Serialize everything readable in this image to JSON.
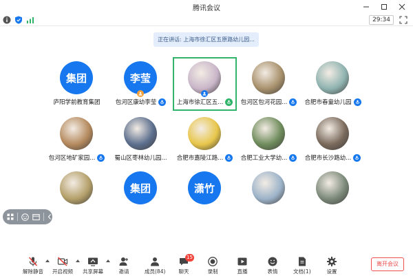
{
  "window": {
    "title": "腾讯会议"
  },
  "status": {
    "timer": "29:34"
  },
  "speaking": {
    "text": "正在讲话: 上海市徐汇区五原路幼儿园..."
  },
  "participants": [
    {
      "name": "庐阳学前教育集团",
      "avatar_text": "集团",
      "photo": false,
      "badge": "",
      "mic": false,
      "active": false
    },
    {
      "name": "包河区康幼李莹",
      "avatar_text": "李莹",
      "photo": false,
      "badge": "host",
      "mic": true,
      "active": false
    },
    {
      "name": "上海市徐汇区五...",
      "avatar_text": "",
      "photo": true,
      "photo_color": "#c9b6c9",
      "badge": "cohost",
      "mic": true,
      "active": true
    },
    {
      "name": "包河区包河花园...",
      "avatar_text": "",
      "photo": true,
      "photo_color": "#a8916c",
      "badge": "",
      "mic": true,
      "active": false
    },
    {
      "name": "合肥市春童幼儿园",
      "avatar_text": "",
      "photo": true,
      "photo_color": "#8fb3b0",
      "badge": "",
      "mic": true,
      "active": false
    },
    {
      "name": "包河区地矿家园...",
      "avatar_text": "",
      "photo": true,
      "photo_color": "#b58a5e",
      "badge": "",
      "mic": true,
      "active": false
    },
    {
      "name": "蜀山区枣林幼儿园...",
      "avatar_text": "",
      "photo": true,
      "photo_color": "#5c6f8e",
      "badge": "",
      "mic": false,
      "active": false
    },
    {
      "name": "合肥市嘉陵江路...",
      "avatar_text": "",
      "photo": true,
      "photo_color": "#e8c64b",
      "badge": "",
      "mic": true,
      "active": false
    },
    {
      "name": "合肥工业大学幼...",
      "avatar_text": "",
      "photo": true,
      "photo_color": "#6f8c5c",
      "badge": "",
      "mic": true,
      "active": false
    },
    {
      "name": "合肥市长沙路幼...",
      "avatar_text": "",
      "photo": true,
      "photo_color": "#7a6a5c",
      "badge": "",
      "mic": true,
      "active": false
    },
    {
      "name": "",
      "avatar_text": "",
      "photo": true,
      "photo_color": "#b4a06a",
      "badge": "",
      "mic": false,
      "active": false
    },
    {
      "name": "",
      "avatar_text": "集团",
      "photo": false,
      "badge": "",
      "mic": false,
      "active": false
    },
    {
      "name": "",
      "avatar_text": "潇竹",
      "photo": false,
      "badge": "",
      "mic": false,
      "active": false
    },
    {
      "name": "",
      "avatar_text": "",
      "photo": true,
      "photo_color": "#9cb3c9",
      "badge": "",
      "mic": false,
      "active": false
    },
    {
      "name": "",
      "avatar_text": "",
      "photo": true,
      "photo_color": "#7c8a7a",
      "badge": "",
      "mic": false,
      "active": false
    }
  ],
  "toolbar": {
    "mute": "解除静音",
    "video": "开启视频",
    "share": "共享屏幕",
    "invite": "邀请",
    "members": "成员(84)",
    "chat": "聊天",
    "chat_count": "15",
    "record": "录制",
    "live": "直播",
    "reactions": "表情",
    "docs": "文档(1)",
    "settings": "设置",
    "leave": "离开会议"
  },
  "colors": {
    "accent": "#1677ee",
    "active_border": "#2fb46a",
    "leave": "#ee4d4d",
    "badge_red": "#f0433a"
  }
}
